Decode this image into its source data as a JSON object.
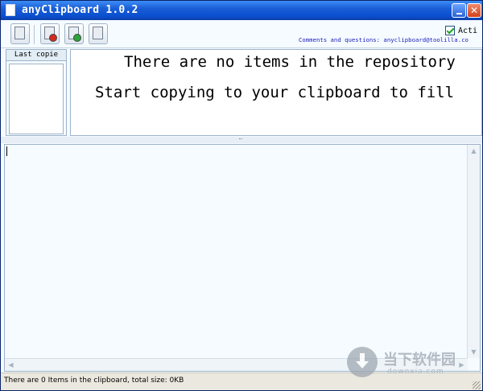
{
  "window": {
    "title": "anyClipboard 1.0.2",
    "minimize_symbol": "_",
    "close_symbol": "✕"
  },
  "toolbar": {
    "buttons": [
      {
        "icon": "clipboard-icon"
      },
      {
        "icon": "delete-icon"
      },
      {
        "icon": "refresh-icon"
      },
      {
        "icon": "document-icon"
      }
    ],
    "active_label": "Acti",
    "contact_text": "Comments and questions: anyclipboard@toolilla.co"
  },
  "left_panel": {
    "header": "Last copie"
  },
  "message_panel": {
    "line1": "There are no items in the repository",
    "line2": "Start copying to your clipboard to fill"
  },
  "statusbar": {
    "text": "There are 0 Items in the clipboard, total size: 0KB"
  },
  "watermark": {
    "chinese": "当下软件园",
    "english": "downxia.com"
  }
}
